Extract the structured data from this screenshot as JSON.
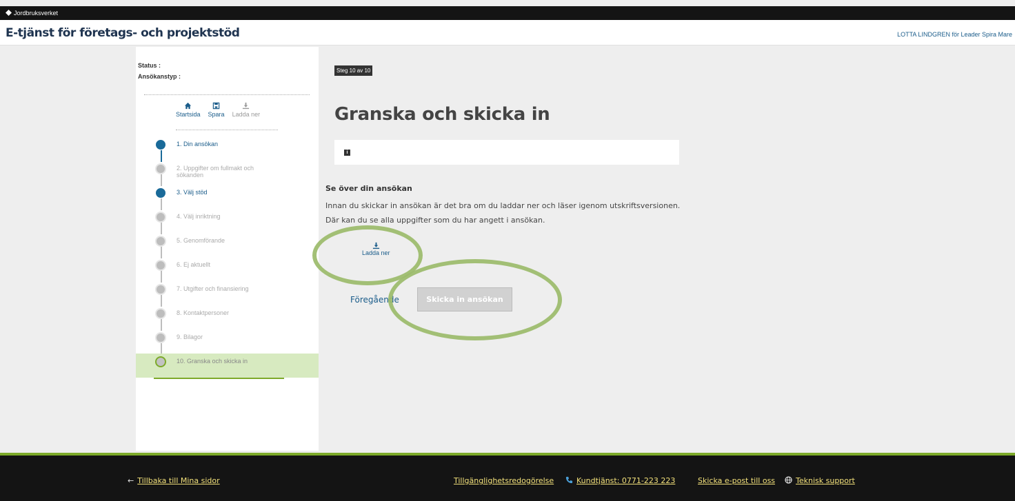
{
  "topbar": {
    "brand": "Jordbruksverket"
  },
  "header": {
    "title": "E-tjänst för företags- och projektstöd",
    "user": "LOTTA LINDGREN för Leader Spira Mare"
  },
  "sidebar": {
    "status_label": "Status :",
    "type_label": "Ansökanstyp :",
    "tools": {
      "home": "Startsida",
      "save": "Spara",
      "download": "Ladda ner"
    },
    "steps": [
      {
        "label": "1. Din ansökan",
        "state": "done"
      },
      {
        "label": "2. Uppgifter om fullmakt och sökanden",
        "state": "pending"
      },
      {
        "label": "3. Välj stöd",
        "state": "done"
      },
      {
        "label": "4. Välj inriktning",
        "state": "pending"
      },
      {
        "label": "5. Genomförande",
        "state": "pending"
      },
      {
        "label": "6. Ej aktuellt",
        "state": "pending"
      },
      {
        "label": "7. Utgifter och finansiering",
        "state": "pending"
      },
      {
        "label": "8. Kontaktpersoner",
        "state": "pending"
      },
      {
        "label": "9. Bilagor",
        "state": "pending"
      },
      {
        "label": "10. Granska och skicka in",
        "state": "active"
      }
    ]
  },
  "main": {
    "step_badge": "Steg 10 av 10",
    "title": "Granska och skicka in",
    "info_icon": "i",
    "review_heading": "Se över din ansökan",
    "review_line1": "Innan du skickar in ansökan är det bra om du laddar ner och läser igenom utskriftsversionen.",
    "review_line2": "Där kan du se alla uppgifter som du har angett i ansökan.",
    "download_label": "Ladda ner",
    "prev_label": "Föregående",
    "submit_label": "Skicka in ansökan"
  },
  "footer": {
    "back": "Tillbaka till Mina sidor",
    "accessibility": "Tillgänglighetsredogörelse",
    "phone": "Kundtjänst: 0771-223 223",
    "email": "Skicka e-post till oss",
    "support": "Teknisk support"
  },
  "colors": {
    "accent_blue": "#1a6a99",
    "highlight_green": "#9bbb6a",
    "footer_link": "#f2e07a"
  }
}
